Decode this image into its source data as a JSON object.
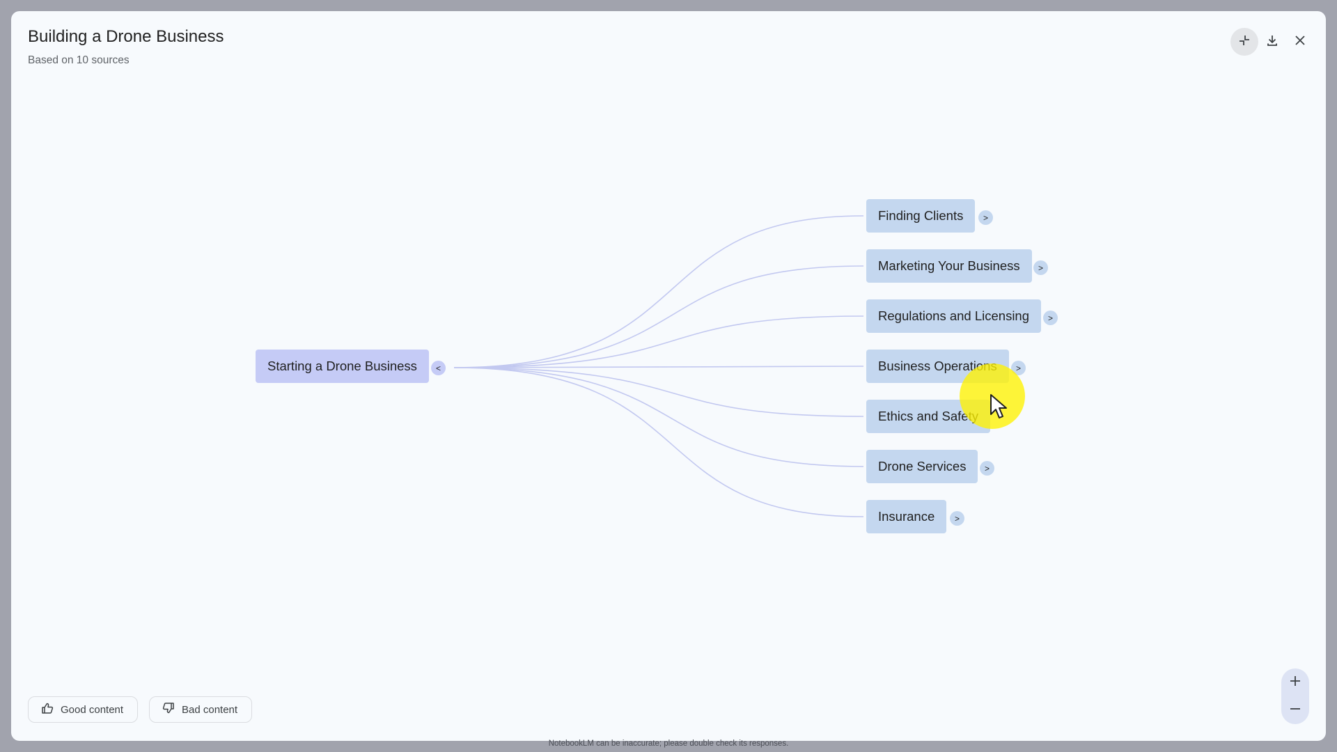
{
  "header": {
    "title": "Building a Drone Business",
    "subtitle": "Based on 10 sources"
  },
  "mindmap": {
    "root": {
      "label": "Starting a Drone Business",
      "toggle": "<"
    },
    "children": [
      {
        "label": "Finding Clients",
        "toggle": ">"
      },
      {
        "label": "Marketing Your Business",
        "toggle": ">"
      },
      {
        "label": "Regulations and Licensing",
        "toggle": ">"
      },
      {
        "label": "Business Operations",
        "toggle": ">"
      },
      {
        "label": "Ethics and Safety",
        "toggle": ">"
      },
      {
        "label": "Drone Services",
        "toggle": ">"
      },
      {
        "label": "Insurance",
        "toggle": ">"
      }
    ]
  },
  "feedback": {
    "good_label": "Good content",
    "bad_label": "Bad content"
  },
  "footer": {
    "disclaimer": "NotebookLM can be inaccurate; please double check its responses."
  },
  "icons": {
    "collapse": "collapse-icon",
    "download": "download-icon",
    "close": "close-icon",
    "thumb_up": "thumb-up-icon",
    "thumb_down": "thumb-down-icon",
    "zoom_in": "plus-icon",
    "zoom_out": "minus-icon"
  },
  "colors": {
    "root_node": "#c5cbf6",
    "child_node": "#c4d7ef",
    "link": "#c2c8f0",
    "dialog_bg": "#f7fafd",
    "backdrop": "#a1a3ad"
  }
}
